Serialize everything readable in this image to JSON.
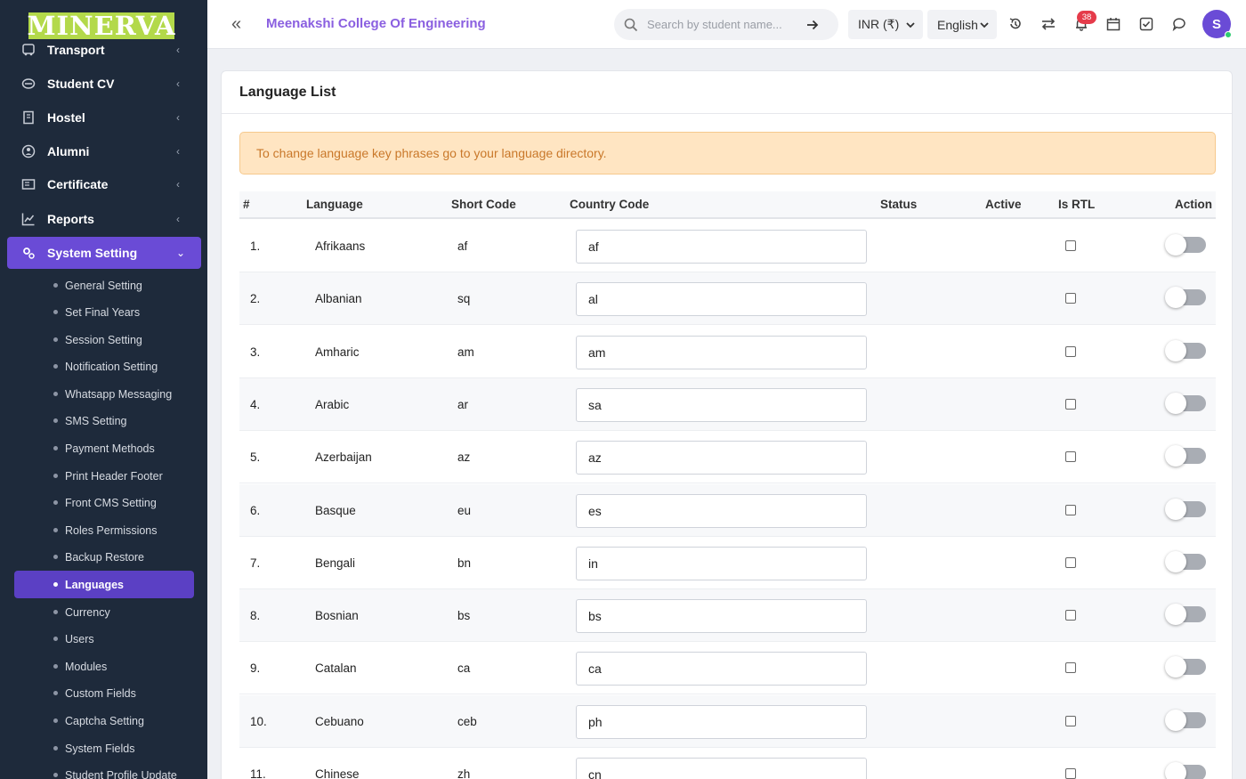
{
  "brand": {
    "logo_text": "MINERVA"
  },
  "sidebar": {
    "menu": [
      {
        "label": "Transport",
        "icon": "bus-icon"
      },
      {
        "label": "Student CV",
        "icon": "cv-icon"
      },
      {
        "label": "Hostel",
        "icon": "building-icon"
      },
      {
        "label": "Alumni",
        "icon": "alumni-icon"
      },
      {
        "label": "Certificate",
        "icon": "certificate-icon"
      },
      {
        "label": "Reports",
        "icon": "chart-line-icon"
      },
      {
        "label": "System Setting",
        "icon": "gears-icon"
      }
    ],
    "submenu": [
      "General Setting",
      "Set Final Years",
      "Session Setting",
      "Notification Setting",
      "Whatsapp Messaging",
      "SMS Setting",
      "Payment Methods",
      "Print Header Footer",
      "Front CMS Setting",
      "Roles Permissions",
      "Backup Restore",
      "Languages",
      "Currency",
      "Users",
      "Modules",
      "Custom Fields",
      "Captcha Setting",
      "System Fields",
      "Student Profile Update"
    ],
    "active_submenu": "Languages"
  },
  "topbar": {
    "college_name": "Meenakshi College Of Engineering",
    "search_placeholder": "Search by student name...",
    "currency": "INR (₹)",
    "language": "English",
    "notification_count": "38",
    "avatar_initial": "S"
  },
  "page": {
    "title": "Language List",
    "alert": "To change language key phrases go to your language directory.",
    "columns": {
      "num": "#",
      "language": "Language",
      "short_code": "Short Code",
      "country_code": "Country Code",
      "status": "Status",
      "active": "Active",
      "is_rtl": "Is RTL",
      "action": "Action"
    },
    "rows": [
      {
        "num": "1.",
        "language": "Afrikaans",
        "short": "af",
        "country": "af",
        "is_rtl": false,
        "enabled": false
      },
      {
        "num": "2.",
        "language": "Albanian",
        "short": "sq",
        "country": "al",
        "is_rtl": false,
        "enabled": false
      },
      {
        "num": "3.",
        "language": "Amharic",
        "short": "am",
        "country": "am",
        "is_rtl": false,
        "enabled": false
      },
      {
        "num": "4.",
        "language": "Arabic",
        "short": "ar",
        "country": "sa",
        "is_rtl": false,
        "enabled": false
      },
      {
        "num": "5.",
        "language": "Azerbaijan",
        "short": "az",
        "country": "az",
        "is_rtl": false,
        "enabled": false
      },
      {
        "num": "6.",
        "language": "Basque",
        "short": "eu",
        "country": "es",
        "is_rtl": false,
        "enabled": false
      },
      {
        "num": "7.",
        "language": "Bengali",
        "short": "bn",
        "country": "in",
        "is_rtl": false,
        "enabled": false
      },
      {
        "num": "8.",
        "language": "Bosnian",
        "short": "bs",
        "country": "bs",
        "is_rtl": false,
        "enabled": false
      },
      {
        "num": "9.",
        "language": "Catalan",
        "short": "ca",
        "country": "ca",
        "is_rtl": false,
        "enabled": false
      },
      {
        "num": "10.",
        "language": "Cebuano",
        "short": "ceb",
        "country": "ph",
        "is_rtl": false,
        "enabled": false
      },
      {
        "num": "11.",
        "language": "Chinese",
        "short": "zh",
        "country": "cn",
        "is_rtl": false,
        "enabled": false
      }
    ]
  }
}
